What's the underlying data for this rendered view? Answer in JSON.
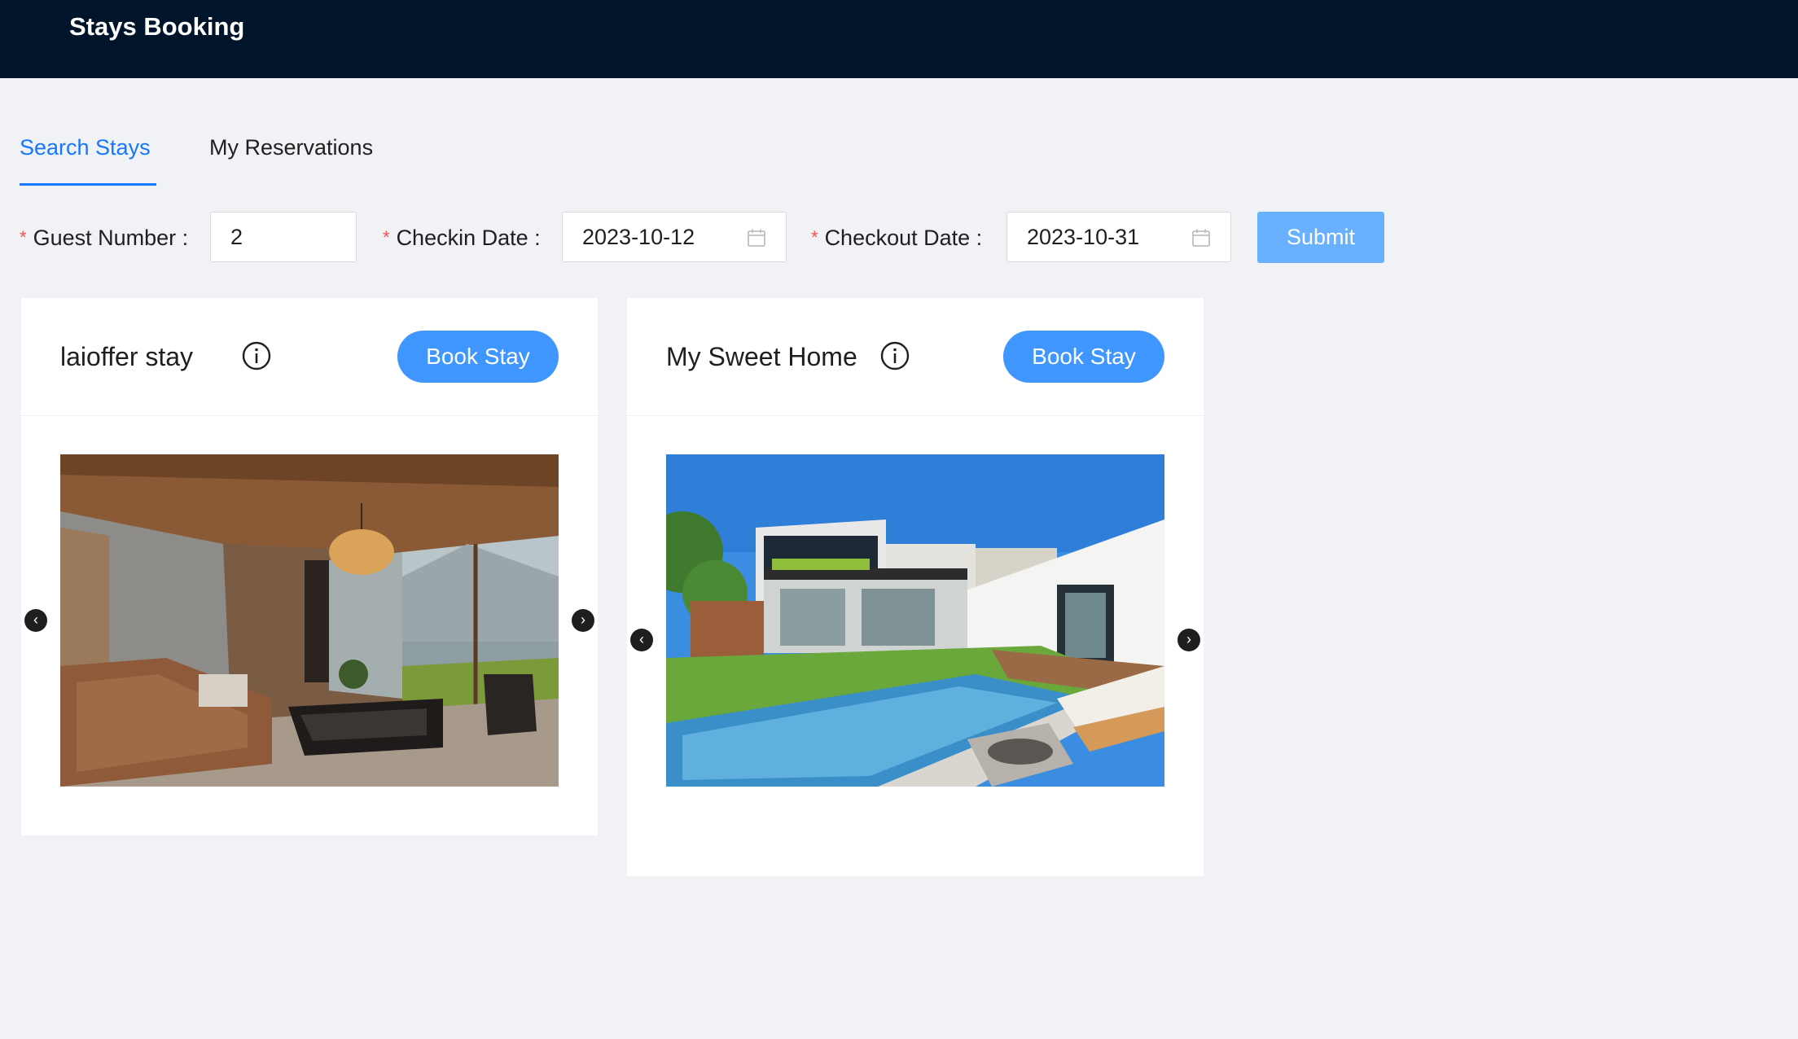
{
  "header": {
    "title": "Stays Booking"
  },
  "tabs": [
    {
      "label": "Search Stays",
      "active": true
    },
    {
      "label": "My Reservations",
      "active": false
    }
  ],
  "search_form": {
    "required_mark": "*",
    "guest_number": {
      "label": "Guest Number",
      "value": "2"
    },
    "checkin_date": {
      "label": "Checkin Date",
      "value": "2023-10-12"
    },
    "checkout_date": {
      "label": "Checkout Date",
      "value": "2023-10-31"
    },
    "submit_label": "Submit"
  },
  "stays": [
    {
      "name": "laioffer stay",
      "book_label": "Book Stay",
      "photo": "living-room-photo"
    },
    {
      "name": "My Sweet Home",
      "book_label": "Book Stay",
      "photo": "backyard-pool-photo"
    }
  ],
  "icons": {
    "info": "info-circle-icon",
    "calendar": "calendar-icon",
    "carousel_prev": "chevron-left-icon",
    "carousel_next": "chevron-right-icon"
  },
  "colors": {
    "header_bg": "#001529",
    "primary": "#1677ff",
    "book_button": "#4096ff",
    "submit_button": "#69b1ff",
    "page_bg": "#f0f2f5"
  }
}
